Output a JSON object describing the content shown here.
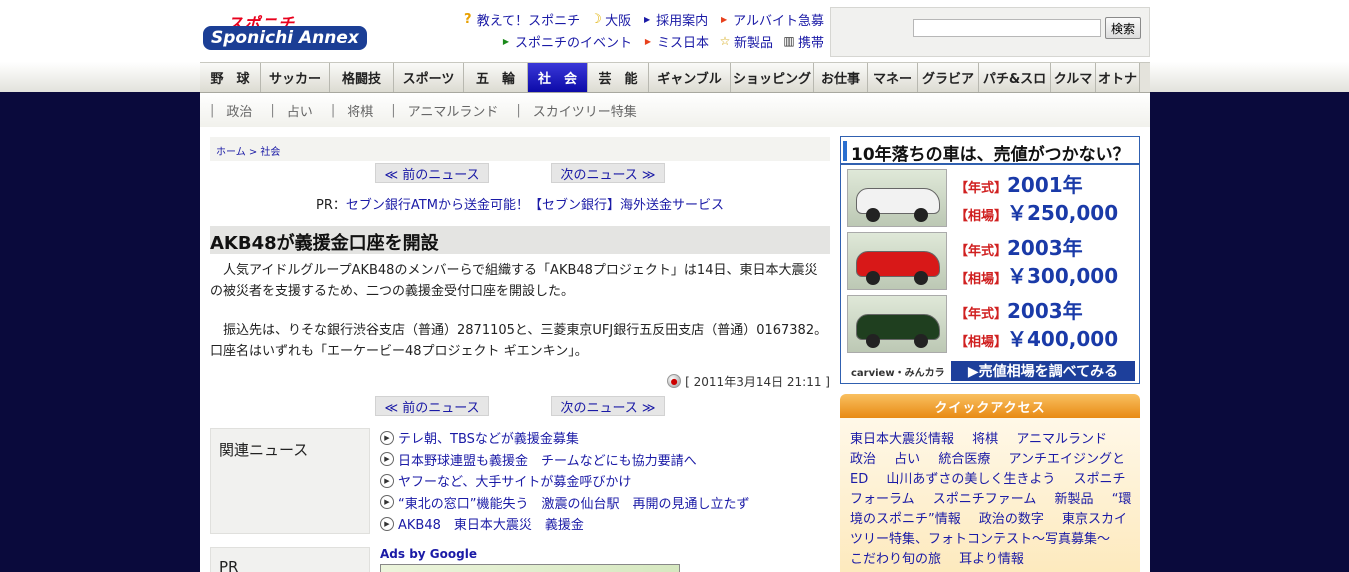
{
  "header": {
    "logo_top": "スポニチ",
    "logo_bottom": "Sponichi Annex",
    "links_row1": [
      "教えて！スポニチ",
      "大阪",
      "採用案内",
      "アルバイト急募"
    ],
    "links_row2": [
      "スポニチのイベント",
      "ミス日本",
      "新製品",
      "携帯"
    ],
    "search_button": "検索",
    "search_value": ""
  },
  "main_nav": [
    "野　球",
    "サッカー",
    "格闘技",
    "スポーツ",
    "五　輪",
    "社　会",
    "芸　能",
    "ギャンブル",
    "ショッピング",
    "お仕事",
    "マネー",
    "グラビア",
    "パチ&スロ",
    "クルマ",
    "オトナ"
  ],
  "main_nav_active": 5,
  "sub_nav": [
    "政治",
    "占い",
    "将棋",
    "アニマルランド",
    "スカイツリー特集"
  ],
  "breadcrumb": "ホーム > 社会",
  "prev_news": "≪ 前のニュース",
  "next_news": "次のニュース ≫",
  "pr": {
    "prefix": "PR：",
    "link": "セブン銀行ATMから送金可能！【セブン銀行】海外送金サービス"
  },
  "article": {
    "title": "AKB48が義援金口座を開設",
    "para1": "　人気アイドルグループAKB48のメンバーらで組織する「AKB48プロジェクト」は14日、東日本大震災の被災者を支援するため、二つの義援金受付口座を開設した。",
    "para2": "　振込先は、りそな銀行渋谷支店（普通）2871105と、三菱東京UFJ銀行五反田支店（普通）0167382。口座名はいずれも「エーケービー48プロジェクト ギエンキン」。",
    "dateline": "[ 2011年3月14日 21:11 ]"
  },
  "related": {
    "label": "関連ニュース",
    "items": [
      "テレ朝、TBSなどが義援金募集",
      "日本野球連盟も義援金　チームなどにも協力要請へ",
      "ヤフーなど、大手サイトが募金呼びかけ",
      "“東北の窓口”機能失う　激震の仙台駅　再開の見通し立たず",
      "AKB48　東日本大震災　義援金"
    ]
  },
  "pr_label": "PR",
  "ads_label": "Ads by Google",
  "car_ad": {
    "headline": "10年落ちの車は、売値がつかない？",
    "cars": [
      {
        "year_tag": "【年式】",
        "year": "2001年",
        "price_tag": "【相場】",
        "price": "￥250,000",
        "color": "#f2f2f2"
      },
      {
        "year_tag": "【年式】",
        "year": "2003年",
        "price_tag": "【相場】",
        "price": "￥300,000",
        "color": "#d81818"
      },
      {
        "year_tag": "【年式】",
        "year": "2003年",
        "price_tag": "【相場】",
        "price": "￥400,000",
        "color": "#1f3f1f"
      }
    ],
    "brand": "carview・みんカラ",
    "cta": "▶売値相場を調べてみる"
  },
  "quick_access": {
    "title": "クイックアクセス",
    "links": [
      "東日本大震災情報",
      "将棋",
      "アニマルランド",
      "政治",
      "占い",
      "統合医療",
      "アンチエイジングとED",
      "山川あずさの美しく生きよう",
      "スポニチフォーラム",
      "スポニチファーム",
      "新製品",
      "“環境のスポニチ”情報",
      "政治の数字",
      "東京スカイツリー特集、フォトコンテスト～写真募集～",
      "こだわり旬の旅",
      "耳より情報"
    ]
  }
}
